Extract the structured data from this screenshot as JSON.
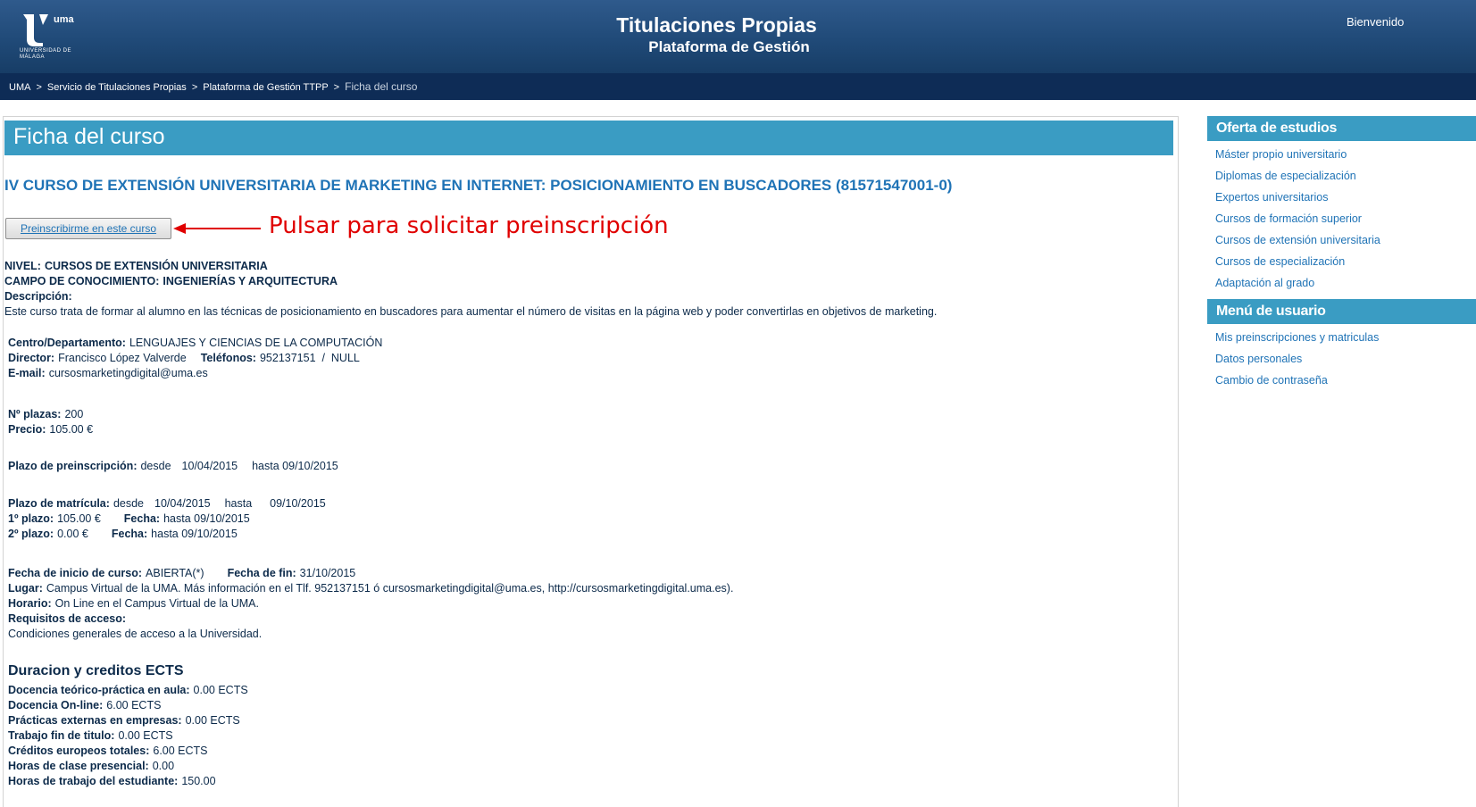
{
  "header": {
    "logo_mark": "uma",
    "logo_sub": "UNIVERSIDAD DE MÁLAGA",
    "title": "Titulaciones Propias",
    "subtitle": "Plataforma de Gestión",
    "welcome": "Bienvenido"
  },
  "breadcrumb": {
    "items": [
      "UMA",
      "Servicio de Titulaciones Propias",
      "Plataforma de Gestión TTPP"
    ],
    "separator": ">",
    "current": "Ficha del curso"
  },
  "main": {
    "page_title": "Ficha del curso",
    "course_title": "IV CURSO DE EXTENSIÓN UNIVERSITARIA DE MARKETING EN INTERNET: POSICIONAMIENTO EN BUSCADORES (81571547001-0)",
    "button_label": "Preinscribirme en este curso",
    "annotation": "Pulsar para solicitar preinscripción",
    "nivel_label": "NIVEL:",
    "nivel_value": "CURSOS DE EXTENSIÓN UNIVERSITARIA",
    "campo_label": "CAMPO DE CONOCIMIENTO:",
    "campo_value": "INGENIERÍAS Y ARQUITECTURA",
    "descripcion_label": "Descripción:",
    "descripcion_value": "Este curso trata de formar al alumno en las técnicas de posicionamiento en buscadores para aumentar el número de visitas en la página web y poder convertirlas en objetivos de marketing.",
    "centro_label": "Centro/Departamento:",
    "centro_value": "LENGUAJES Y CIENCIAS DE LA COMPUTACIÓN",
    "director_label": "Director:",
    "director_value": "Francisco López Valverde",
    "telefonos_label": "Teléfonos:",
    "telefonos_value": "952137151  /  NULL",
    "email_label": "E-mail:",
    "email_value": "cursosmarketingdigital@uma.es",
    "plazas_label": "Nº plazas:",
    "plazas_value": "200",
    "precio_label": "Precio:",
    "precio_value": "105.00 €",
    "preins_label": "Plazo de preinscripción:",
    "preins_desde": "desde",
    "preins_desde_value": "10/04/2015",
    "preins_hasta": "hasta 09/10/2015",
    "matricula_label": "Plazo de matrícula:",
    "matricula_desde": "desde",
    "matricula_desde_value": "10/04/2015",
    "matricula_hasta": "hasta",
    "matricula_hasta_value": "09/10/2015",
    "plazo1_label": "1º plazo:",
    "plazo1_value": "105.00 €",
    "plazo1_fecha_label": "Fecha:",
    "plazo1_fecha_value": "hasta 09/10/2015",
    "plazo2_label": "2º plazo:",
    "plazo2_value": "0.00 €",
    "plazo2_fecha_label": "Fecha:",
    "plazo2_fecha_value": "hasta 09/10/2015",
    "inicio_label": "Fecha de inicio de curso:",
    "inicio_value": "ABIERTA(*)",
    "fin_label": "Fecha de fin:",
    "fin_value": "31/10/2015",
    "lugar_label": "Lugar:",
    "lugar_value": "Campus Virtual de la UMA. Más información en el Tlf. 952137151 ó cursosmarketingdigital@uma.es, http://cursosmarketingdigital.uma.es).",
    "horario_label": "Horario:",
    "horario_value": "On Line en el Campus Virtual de la UMA.",
    "requisitos_label": "Requisitos de acceso:",
    "requisitos_value": "Condiciones generales de acceso a la Universidad.",
    "ects_title": "Duracion y creditos ECTS",
    "ects": [
      {
        "label": "Docencia teórico-práctica en aula:",
        "value": "0.00 ECTS"
      },
      {
        "label": "Docencia On-line:",
        "value": "6.00 ECTS"
      },
      {
        "label": "Prácticas externas en empresas:",
        "value": "0.00 ECTS"
      },
      {
        "label": "Trabajo fin de titulo:",
        "value": "0.00 ECTS"
      },
      {
        "label": "Créditos europeos totales:",
        "value": "6.00 ECTS"
      },
      {
        "label": "Horas de clase presencial:",
        "value": "0.00"
      },
      {
        "label": "Horas de trabajo del estudiante:",
        "value": "150.00"
      }
    ]
  },
  "sidebar": {
    "oferta_title": "Oferta de estudios",
    "oferta_items": [
      "Máster propio universitario",
      "Diplomas de especialización",
      "Expertos universitarios",
      "Cursos de formación superior",
      "Cursos de extensión universitaria",
      "Cursos de especialización",
      "Adaptación al grado"
    ],
    "menu_title": "Menú de usuario",
    "menu_items": [
      "Mis preinscripciones y matriculas",
      "Datos personales",
      "Cambio de contraseña"
    ]
  },
  "colors": {
    "header_bg": "#204a78",
    "breadcrumb_bg": "#0e2c56",
    "accent": "#3a9cc3",
    "link": "#1f73b6",
    "annotation": "#e00000"
  }
}
